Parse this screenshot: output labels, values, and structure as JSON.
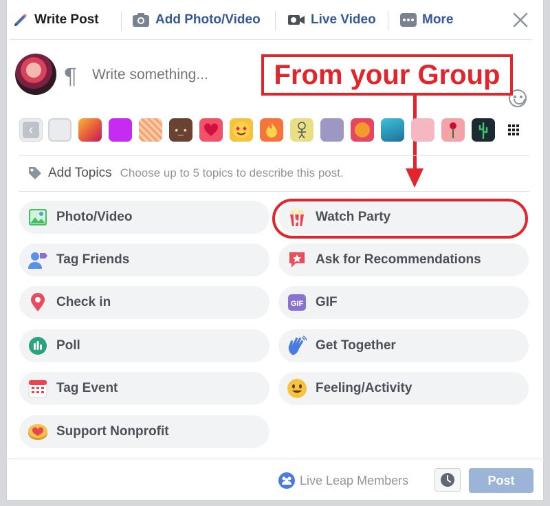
{
  "header": {
    "tabs": [
      {
        "label": "Write Post",
        "icon": "pencil-icon"
      },
      {
        "label": "Add Photo/Video",
        "icon": "camera-icon"
      },
      {
        "label": "Live Video",
        "icon": "video-camera-icon"
      },
      {
        "label": "More",
        "icon": "more-dots-icon"
      }
    ],
    "close_icon": "close-icon"
  },
  "composer": {
    "placeholder": "Write something...",
    "annotation_text": "From your Group"
  },
  "backgrounds": [
    {
      "icon": "chevron-left-icon",
      "color": "#bec3c9"
    },
    {
      "icon": "blank-background",
      "color": "#e9ebee"
    },
    {
      "icon": "gradient-background",
      "color": "#e8613c"
    },
    {
      "icon": "purple-background",
      "color": "#c52bf0"
    },
    {
      "icon": "leaf-pattern-background",
      "color": "#f7c9a4"
    },
    {
      "icon": "emoji-dark-background",
      "color": "#6b4232"
    },
    {
      "icon": "heart-background",
      "color": "#f25268"
    },
    {
      "icon": "heart-eyes-background",
      "color": "#f7c23e"
    },
    {
      "icon": "fire-background",
      "color": "#f4743c"
    },
    {
      "icon": "doodle-background",
      "color": "#e8df85"
    },
    {
      "icon": "cube-background",
      "color": "#9d97c4"
    },
    {
      "icon": "orange-fruit-background",
      "color": "#e7465f"
    },
    {
      "icon": "water-background",
      "color": "#1f8ba8"
    },
    {
      "icon": "pink-eye-background",
      "color": "#f5b7c1"
    },
    {
      "icon": "rose-background",
      "color": "#f3a3a8"
    },
    {
      "icon": "cactus-background",
      "color": "#1b2a33"
    },
    {
      "icon": "grid-icon",
      "color": "#ffffff"
    }
  ],
  "topics": {
    "label": "Add Topics",
    "hint": "Choose up to 5 topics to describe this post."
  },
  "actions": [
    {
      "label": "Photo/Video",
      "icon": "photo-icon"
    },
    {
      "label": "Watch Party",
      "icon": "popcorn-icon"
    },
    {
      "label": "Tag Friends",
      "icon": "tag-friends-icon"
    },
    {
      "label": "Ask for Recommendations",
      "icon": "recommendation-icon"
    },
    {
      "label": "Check in",
      "icon": "location-pin-icon"
    },
    {
      "label": "GIF",
      "icon": "gif-icon"
    },
    {
      "label": "Poll",
      "icon": "poll-icon"
    },
    {
      "label": "Get Together",
      "icon": "wave-hand-icon"
    },
    {
      "label": "Tag Event",
      "icon": "calendar-icon"
    },
    {
      "label": "Feeling/Activity",
      "icon": "smiley-icon"
    },
    {
      "label": "Support Nonprofit",
      "icon": "heart-coin-icon"
    }
  ],
  "footer": {
    "audience_label": "Live Leap Members",
    "post_label": "Post"
  },
  "colors": {
    "accent_link": "#365899",
    "annotation_red": "#e4242b",
    "post_button_disabled": "#9cb4d8"
  }
}
